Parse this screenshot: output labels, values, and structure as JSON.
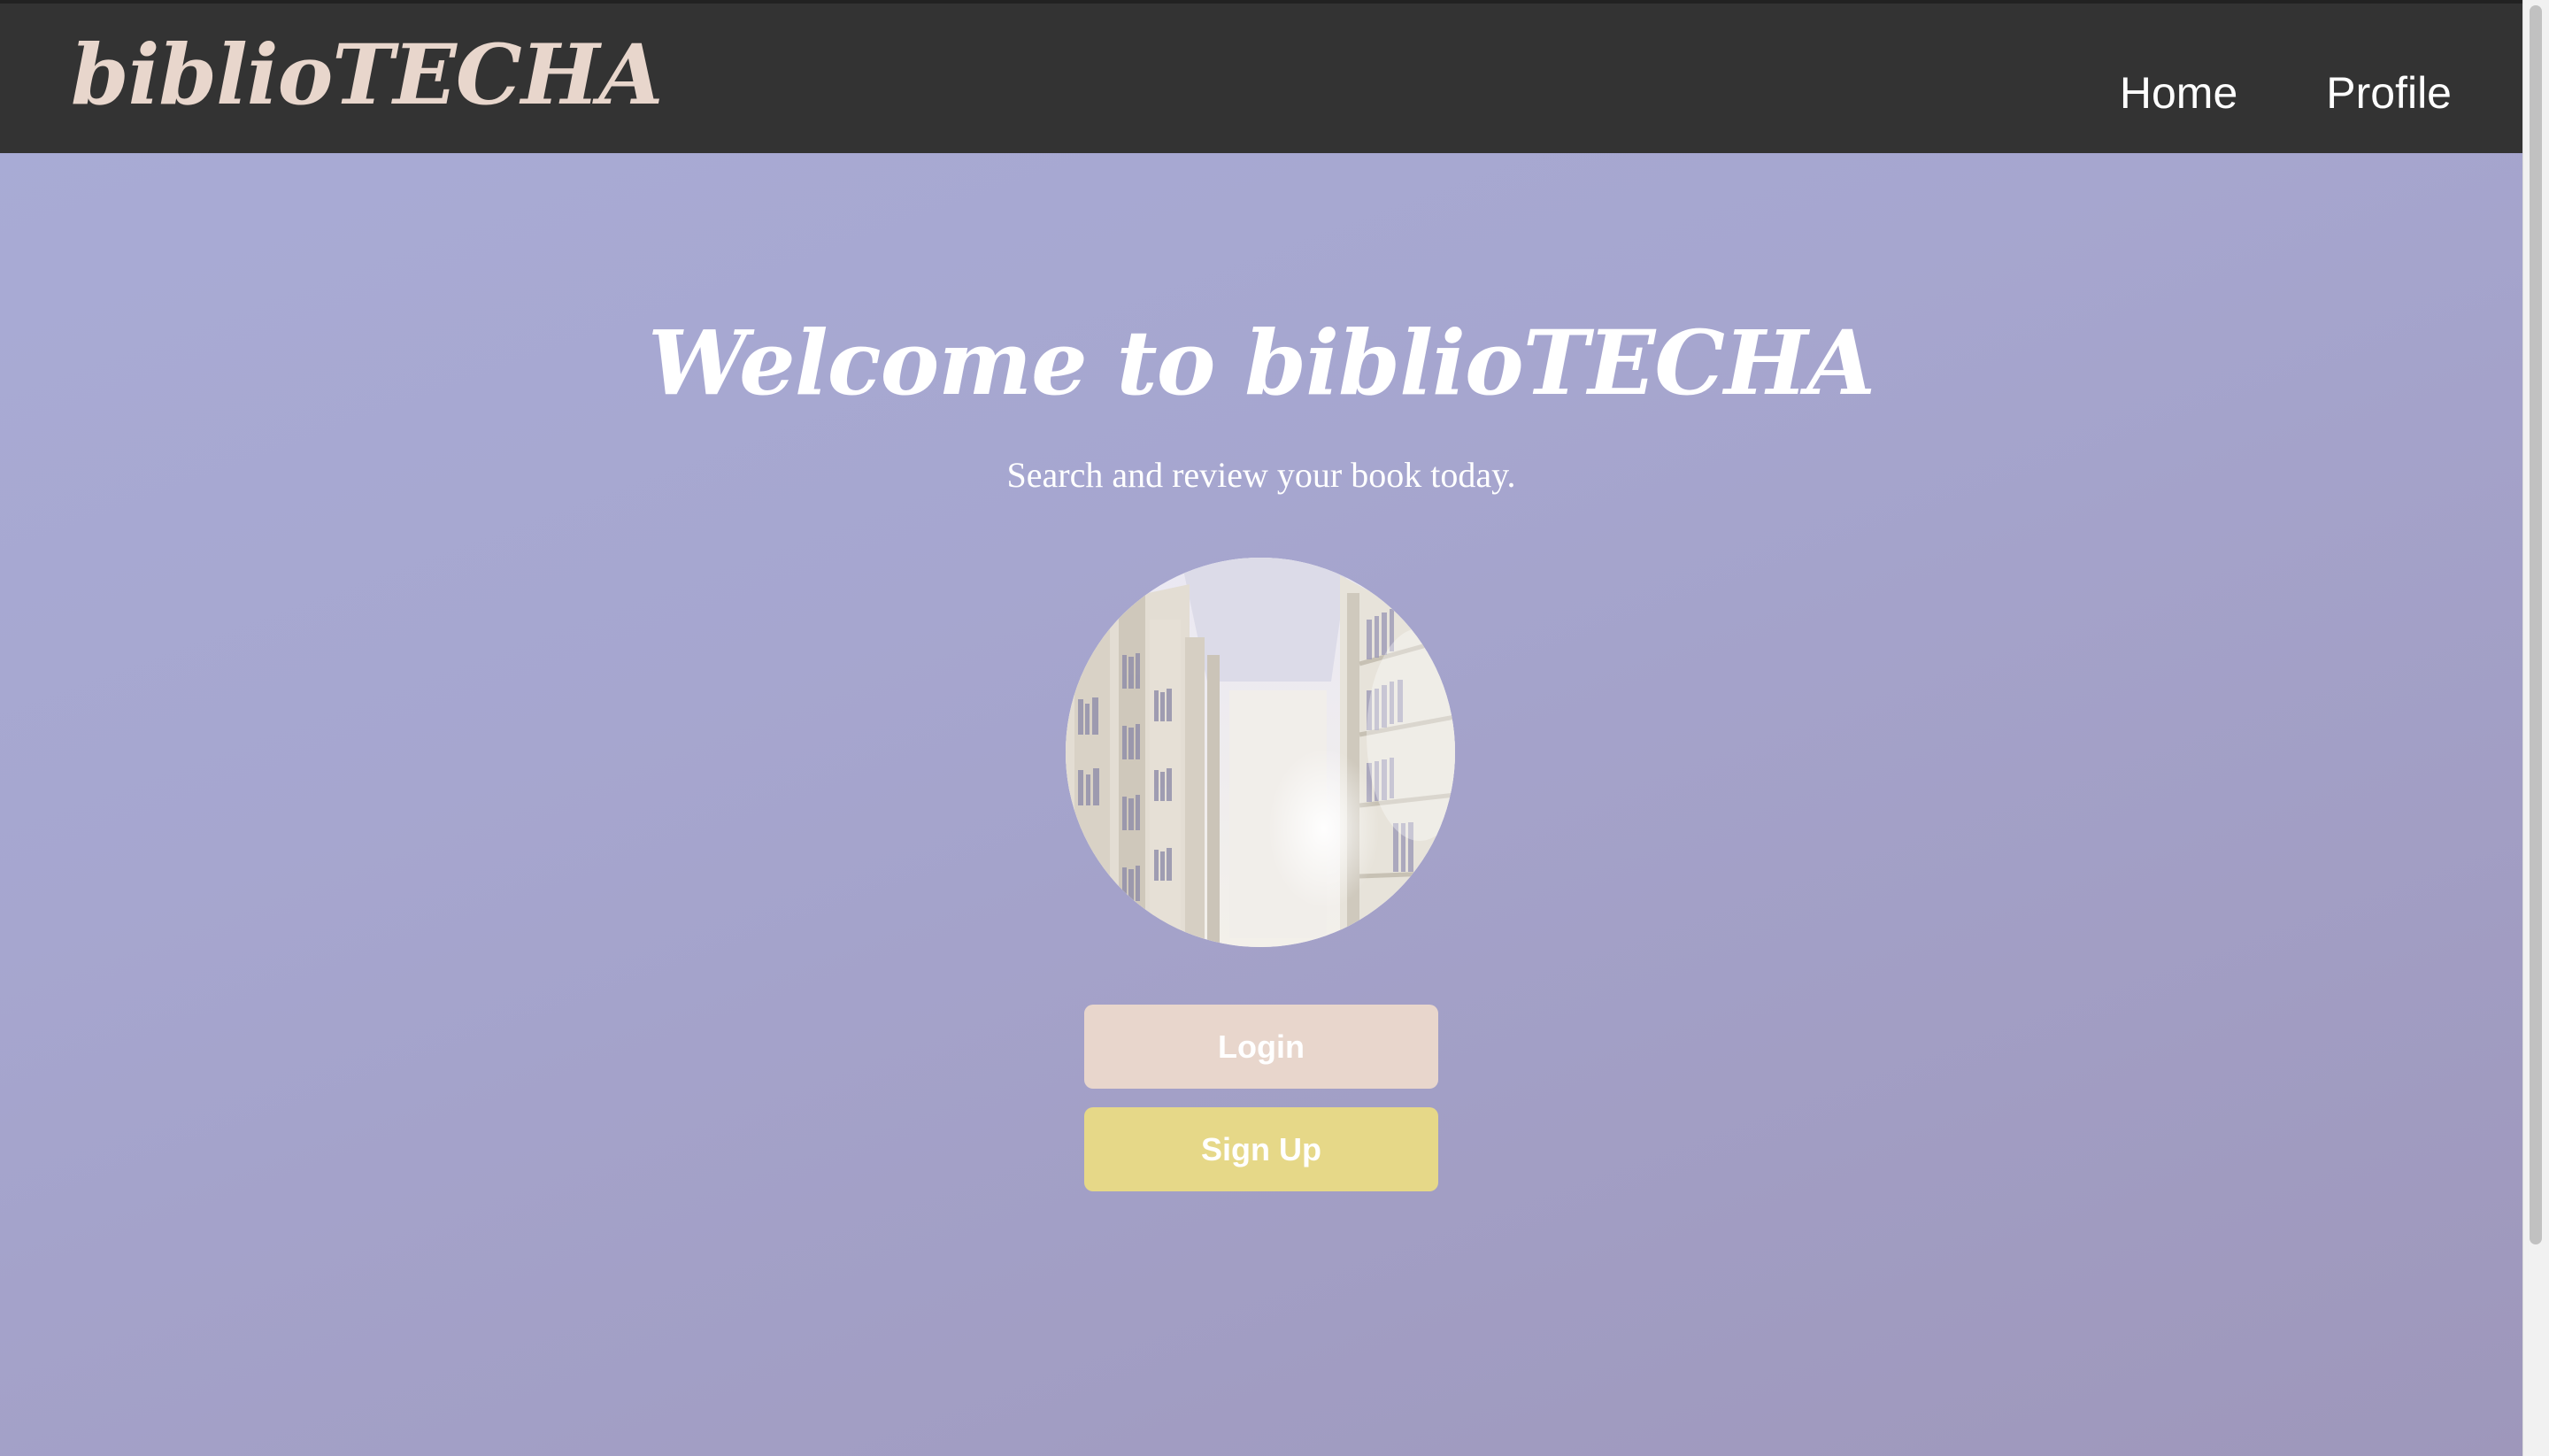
{
  "navbar": {
    "brand": "biblioTECHA",
    "links": [
      {
        "label": "Home"
      },
      {
        "label": "Profile"
      }
    ]
  },
  "hero": {
    "title": "Welcome to biblioTECHA",
    "subtitle": "Search and review your book today.",
    "image_alt": "library bookshelves illustration"
  },
  "actions": {
    "login_label": "Login",
    "signup_label": "Sign Up"
  },
  "colors": {
    "navbar_bg": "#333333",
    "brand": "#e8d6cc",
    "gradient_start": "#a9acd6",
    "gradient_end": "#9e97bb",
    "login_button": "#e8d6cc",
    "signup_button": "#e6d888"
  }
}
